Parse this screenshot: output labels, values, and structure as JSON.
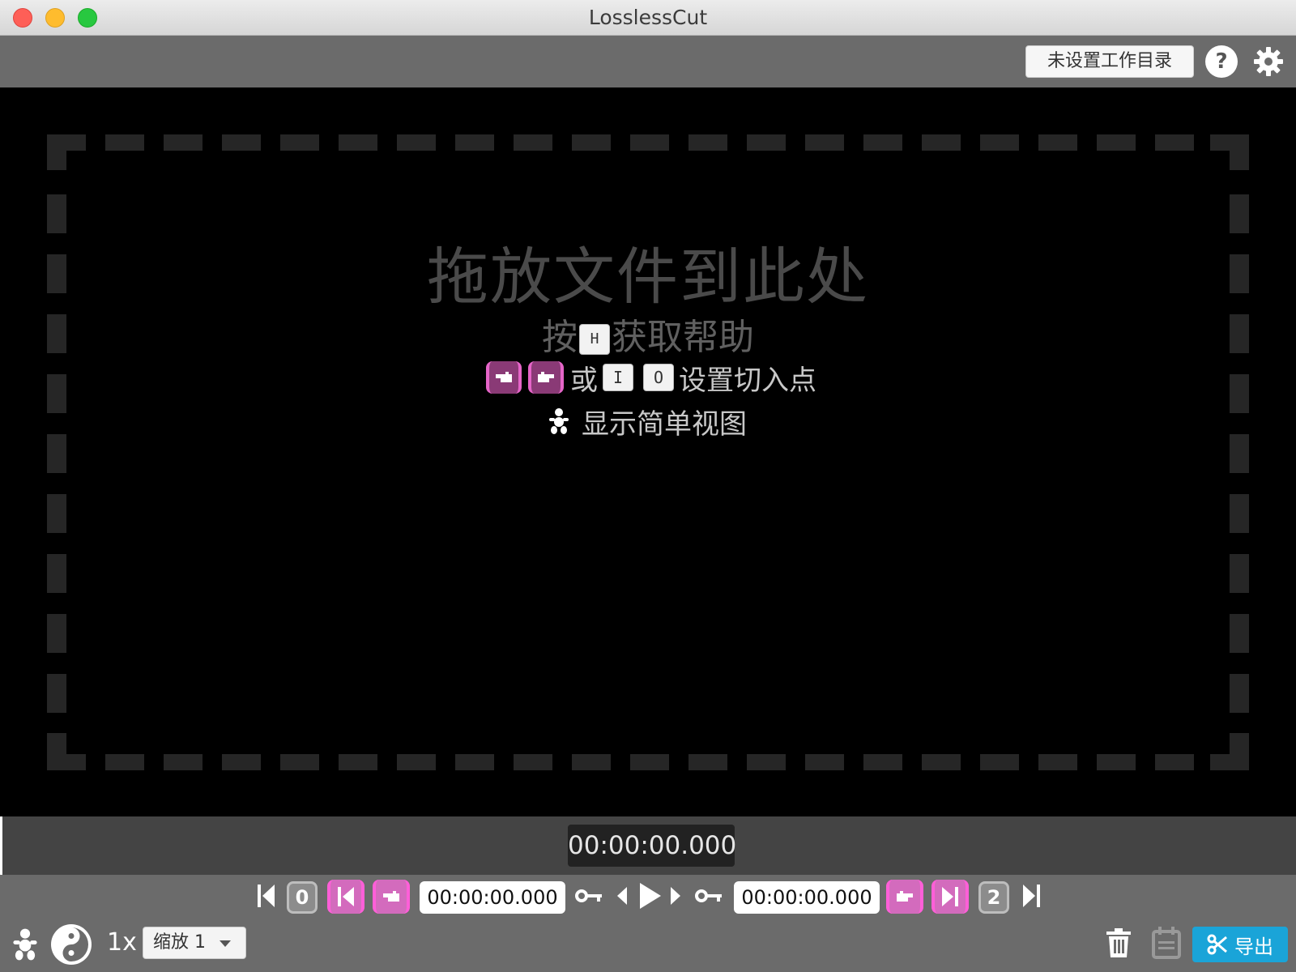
{
  "window": {
    "title": "LosslessCut"
  },
  "toolbar": {
    "workdir_label": "未设置工作目录",
    "help_icon": "?",
    "settings_icon": "gear-icon"
  },
  "drop_area": {
    "title": "拖放文件到此处",
    "help_prefix": "按",
    "help_key": "H",
    "help_suffix": "获取帮助",
    "cut_or": "或",
    "cut_key_in": "I",
    "cut_key_out": "O",
    "cut_suffix": "设置切入点",
    "simple_view": "显示简单视图"
  },
  "timeline": {
    "current_time": "00:00:00.000"
  },
  "controls": {
    "start_segment_number": "0",
    "end_segment_number": "2",
    "cut_start_time": "00:00:00.000",
    "cut_end_time": "00:00:00.000",
    "speed": "1x",
    "zoom_label": "缩放 1",
    "export_label": "导出"
  },
  "colors": {
    "accent_pink": "#e565c8",
    "export_blue": "#1aa4d8",
    "toolbar_grey": "#6b6b6b"
  }
}
